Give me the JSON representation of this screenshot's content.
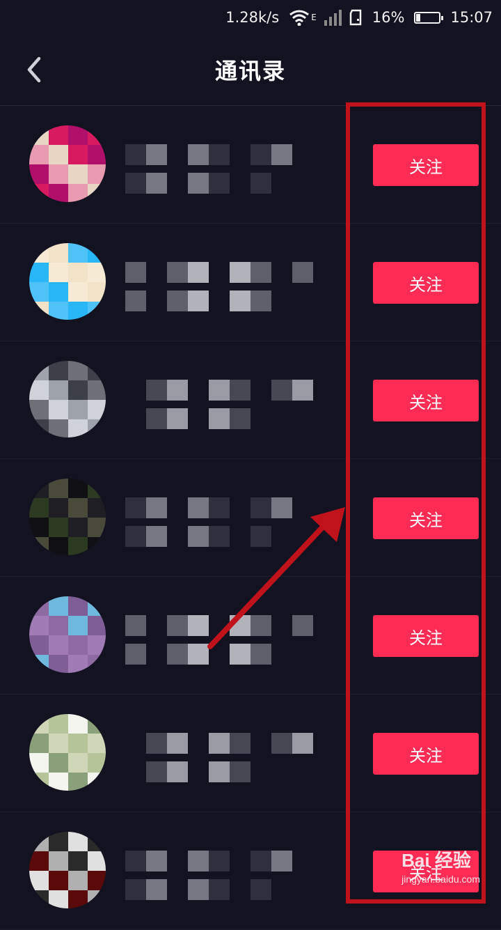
{
  "status_bar": {
    "speed": "1.28k/s",
    "network_type": "E",
    "battery_percent": "16%",
    "battery_level": 0.16,
    "time": "15:07"
  },
  "header": {
    "back_icon": "chevron-left-icon",
    "title": "通讯录"
  },
  "contacts": [
    {
      "avatar_colors": [
        "#e7d7c4",
        "#d81b60",
        "#b0106a",
        "#e89bb0"
      ],
      "follow_label": "关注"
    },
    {
      "avatar_colors": [
        "#f1e2c8",
        "#4fc3f7",
        "#29b6f6",
        "#f6ead4"
      ],
      "follow_label": "关注"
    },
    {
      "avatar_colors": [
        "#6e7077",
        "#cfd2d8",
        "#9ea2aa",
        "#3d4048"
      ],
      "follow_label": "关注"
    },
    {
      "avatar_colors": [
        "#2c3a22",
        "#1e1e24",
        "#4a4a3a",
        "#101014"
      ],
      "follow_label": "关注"
    },
    {
      "avatar_colors": [
        "#8e6aa3",
        "#6fb9df",
        "#7f5d96",
        "#a07bb6"
      ],
      "follow_label": "关注"
    },
    {
      "avatar_colors": [
        "#b6c49a",
        "#f5f5f0",
        "#8aa07a",
        "#d0d6b8"
      ],
      "follow_label": "关注"
    },
    {
      "avatar_colors": [
        "#e0e0e0",
        "#5a0a0a",
        "#b0b0b0",
        "#2a2a2a"
      ],
      "follow_label": "关注"
    }
  ],
  "annotation": {
    "box_color": "#c0121b",
    "arrow_color": "#c0121b"
  },
  "watermark": {
    "brand": "Bai 经验",
    "url": "jingyan.baidu.com"
  }
}
